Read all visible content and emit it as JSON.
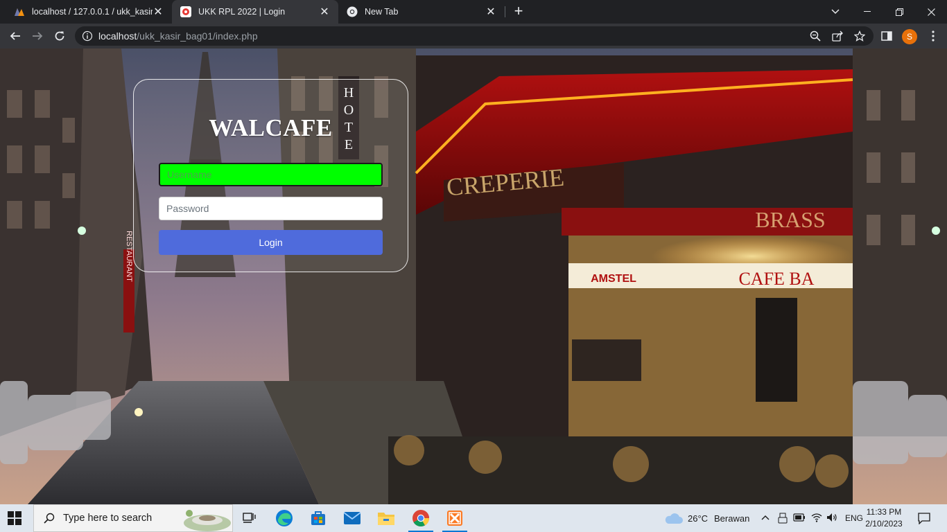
{
  "browser": {
    "tabs": [
      {
        "title": "localhost / 127.0.0.1 / ukk_kasir_b",
        "icon": "phpmyadmin-icon",
        "active": false
      },
      {
        "title": "UKK RPL 2022 | Login",
        "icon": "site-favicon-icon",
        "active": true
      },
      {
        "title": "New Tab",
        "icon": "chrome-icon",
        "active": false
      }
    ],
    "url_host": "localhost",
    "url_path": "/ukk_kasir_bag01/index.php",
    "profile_initial": "S"
  },
  "page": {
    "brand": "WALCAFE",
    "username_placeholder": "Username",
    "password_placeholder": "Password",
    "login_label": "Login",
    "colors": {
      "username_bg": "#00ff00",
      "login_btn": "#4f6bdc"
    }
  },
  "taskbar": {
    "search_placeholder": "Type here to search",
    "weather_temp": "26°C",
    "weather_text": "Berawan",
    "language": "ENG",
    "time": "11:33 PM",
    "date": "2/10/2023"
  }
}
